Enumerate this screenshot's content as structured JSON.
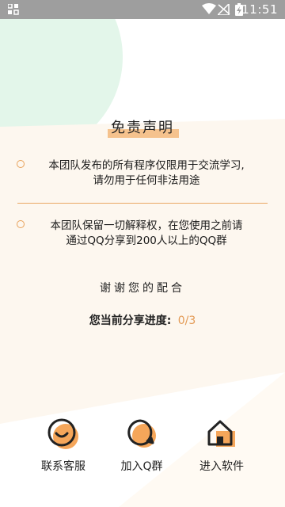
{
  "status_bar": {
    "time": "11:51",
    "icons": [
      "notification-icon",
      "wifi-icon",
      "no-signal-icon",
      "battery-charging-icon"
    ]
  },
  "colors": {
    "accent": "#f0a85a",
    "accent_light": "#f5c28d",
    "mint_bg": "#e3f6ea",
    "cream_bg": "#fdf6ee",
    "progress_value": "#e39a55"
  },
  "title": "免责声明",
  "notices": [
    {
      "lines": [
        "本团队发布的所有程序仅限用于交流学习,",
        "请勿用于任何非法用途"
      ]
    },
    {
      "lines": [
        "本团队保留一切解释权，在您使用之前请",
        "通过QQ分享到200人以上的QQ群"
      ]
    }
  ],
  "thanks": "谢谢您的配合",
  "progress": {
    "label": "您当前分享进度:",
    "value": "0/3"
  },
  "actions": [
    {
      "label": "联系客服",
      "icon": "smile-face-icon"
    },
    {
      "label": "加入Q群",
      "icon": "chat-bubble-icon"
    },
    {
      "label": "进入软件",
      "icon": "home-icon"
    }
  ]
}
